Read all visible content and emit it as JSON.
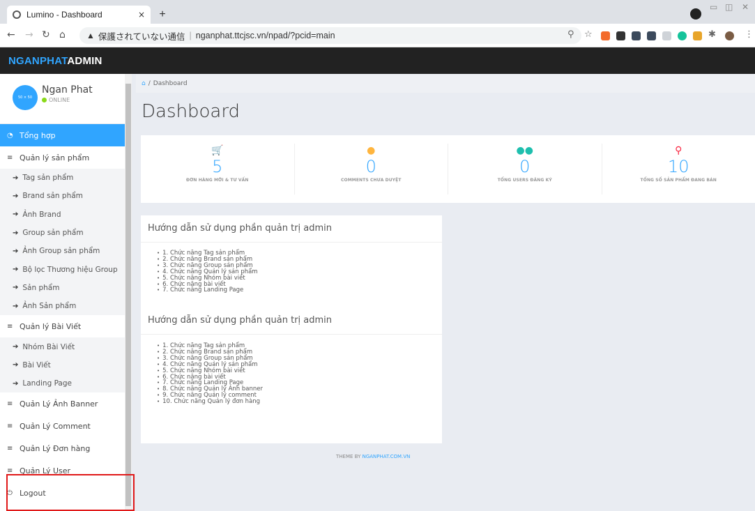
{
  "browser": {
    "tab_title": "Lumino - Dashboard",
    "tab_close": "×",
    "new_tab": "+",
    "url_warning": "保護されていない通信",
    "url": "nganphat.ttcjsc.vn/npad/?pcid=main"
  },
  "header": {
    "brand_part1": "NGANPHAT",
    "brand_part2": "ADMIN"
  },
  "profile": {
    "name": "Ngan Phat",
    "status": "ONLINE",
    "avatar_text": "50 × 50"
  },
  "sidebar": {
    "items": [
      {
        "label": "Tổng hợp",
        "icon": "dashboard-icon",
        "type": "item",
        "active": true
      },
      {
        "label": "Quản lý sản phẩm",
        "icon": "bars-icon",
        "type": "item"
      },
      {
        "label": "Tag sản phẩm",
        "type": "sub"
      },
      {
        "label": "Brand sản phẩm",
        "type": "sub"
      },
      {
        "label": "Ảnh Brand",
        "type": "sub"
      },
      {
        "label": "Group sản phẩm",
        "type": "sub"
      },
      {
        "label": "Ảnh Group sản phẩm",
        "type": "sub"
      },
      {
        "label": "Bộ lọc Thương hiệu Group",
        "type": "sub"
      },
      {
        "label": "Sản phẩm",
        "type": "sub"
      },
      {
        "label": "Ảnh Sản phẩm",
        "type": "sub"
      },
      {
        "label": "Quản lý Bài Viết",
        "icon": "bars-icon",
        "type": "item"
      },
      {
        "label": "Nhóm Bài Viết",
        "type": "sub"
      },
      {
        "label": "Bài Viết",
        "type": "sub"
      },
      {
        "label": "Landing Page",
        "type": "sub"
      },
      {
        "label": "Quản Lý Ảnh Banner",
        "icon": "bars-icon",
        "type": "item"
      },
      {
        "label": "Quản Lý Comment",
        "icon": "bars-icon",
        "type": "item"
      },
      {
        "label": "Quản Lý Đơn hàng",
        "icon": "bars-icon",
        "type": "item"
      },
      {
        "label": "Quản Lý User",
        "icon": "bars-icon",
        "type": "item"
      },
      {
        "label": "Logout",
        "icon": "power-icon",
        "type": "item"
      }
    ]
  },
  "breadcrumb": {
    "current": "Dashboard"
  },
  "page_title": "Dashboard",
  "stats": [
    {
      "value": "5",
      "label": "ĐƠN HÀNG MỚI & TƯ VẤN",
      "icon": "cart-icon",
      "color": "#30a5ff"
    },
    {
      "value": "0",
      "label": "COMMENTS CHƯA DUYỆT",
      "icon": "comments-icon",
      "color": "#ffb53e"
    },
    {
      "value": "0",
      "label": "TỔNG USERS ĐĂNG KÝ",
      "icon": "users-icon",
      "color": "#1ebfae"
    },
    {
      "value": "10",
      "label": "TỔNG SỐ SẢN PHẨM ĐANG BÁN",
      "icon": "search-icon",
      "color": "#f9243f"
    }
  ],
  "guides": [
    {
      "heading": "Hướng dẫn sử dụng phần quản trị admin",
      "items": [
        "1. Chức năng Tag sản phẩm",
        "2. Chức năng Brand sản phẩm",
        "3. Chức năng Group sản phẩm",
        "4. Chức năng Quản lý sản phẩm",
        "5. Chức năng Nhóm bài viết",
        "6. Chức năng bài viết",
        "7. Chức năng Landing Page"
      ]
    },
    {
      "heading": "Hướng dẫn sử dụng phần quản trị admin",
      "items": [
        "1. Chức năng Tag sản phẩm",
        "2. Chức năng Brand sản phẩm",
        "3. Chức năng Group sản phẩm",
        "4. Chức năng Quản lý sản phẩm",
        "5. Chức năng Nhóm bài viết",
        "6. Chức năng bài viết",
        "7. Chức năng Landing Page",
        "8. Chức năng Quản lý Ảnh banner",
        "9. Chức năng Quản lý comment",
        "10. Chức năng Quản lý đơn hàng"
      ]
    }
  ],
  "footer": {
    "prefix": "THEME BY ",
    "link": "NGANPHAT.COM.VN"
  },
  "colors": {
    "accent": "#30a5ff",
    "header_bg": "#222222",
    "highlight": "#e01818"
  }
}
